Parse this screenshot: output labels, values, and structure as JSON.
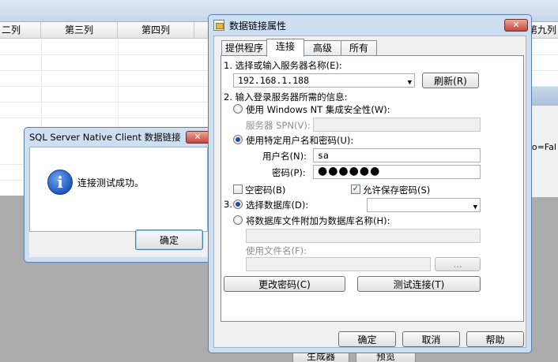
{
  "background": {
    "columns": [
      "二列",
      "第三列",
      "第四列"
    ],
    "right_column": "第九列",
    "right_text": "nfo=Fal",
    "bottom_buttons": [
      "生成器",
      "预览"
    ]
  },
  "message_box": {
    "title": "SQL Server Native Client 数据链接",
    "close_glyph": "✕",
    "icon_glyph": "i",
    "message": "连接测试成功。",
    "ok_label": "确定"
  },
  "dialog": {
    "title": "数据链接属性",
    "close_glyph": "✕",
    "tabs": [
      "提供程序",
      "连接",
      "高级",
      "所有"
    ],
    "step1": "1. 选择或输入服务器名称(E):",
    "server_value": "192.168.1.188",
    "refresh_label": "刷新(R)",
    "step2": "2. 输入登录服务器所需的信息:",
    "windows_auth": "使用 Windows NT 集成安全性(W):",
    "server_spn_label": "服务器 SPN(V):",
    "sql_auth": "使用特定用户名和密码(U):",
    "username_label": "用户名(N):",
    "username_value": "sa",
    "password_label": "密码(P):",
    "password_value": "●●●●●●",
    "blank_password": "空密码(B)",
    "allow_save_password": "允许保存密码(S)",
    "check_mark": "✓",
    "step3_num": "3.",
    "select_db": "选择数据库(D):",
    "attach_db": "将数据库文件附加为数据库名称(H):",
    "use_filename_label": "使用文件名(F):",
    "browse_label": "...",
    "change_password_label": "更改密码(C)",
    "test_connection_label": "测试连接(T)",
    "ok_label": "确定",
    "cancel_label": "取消",
    "help_label": "帮助"
  }
}
